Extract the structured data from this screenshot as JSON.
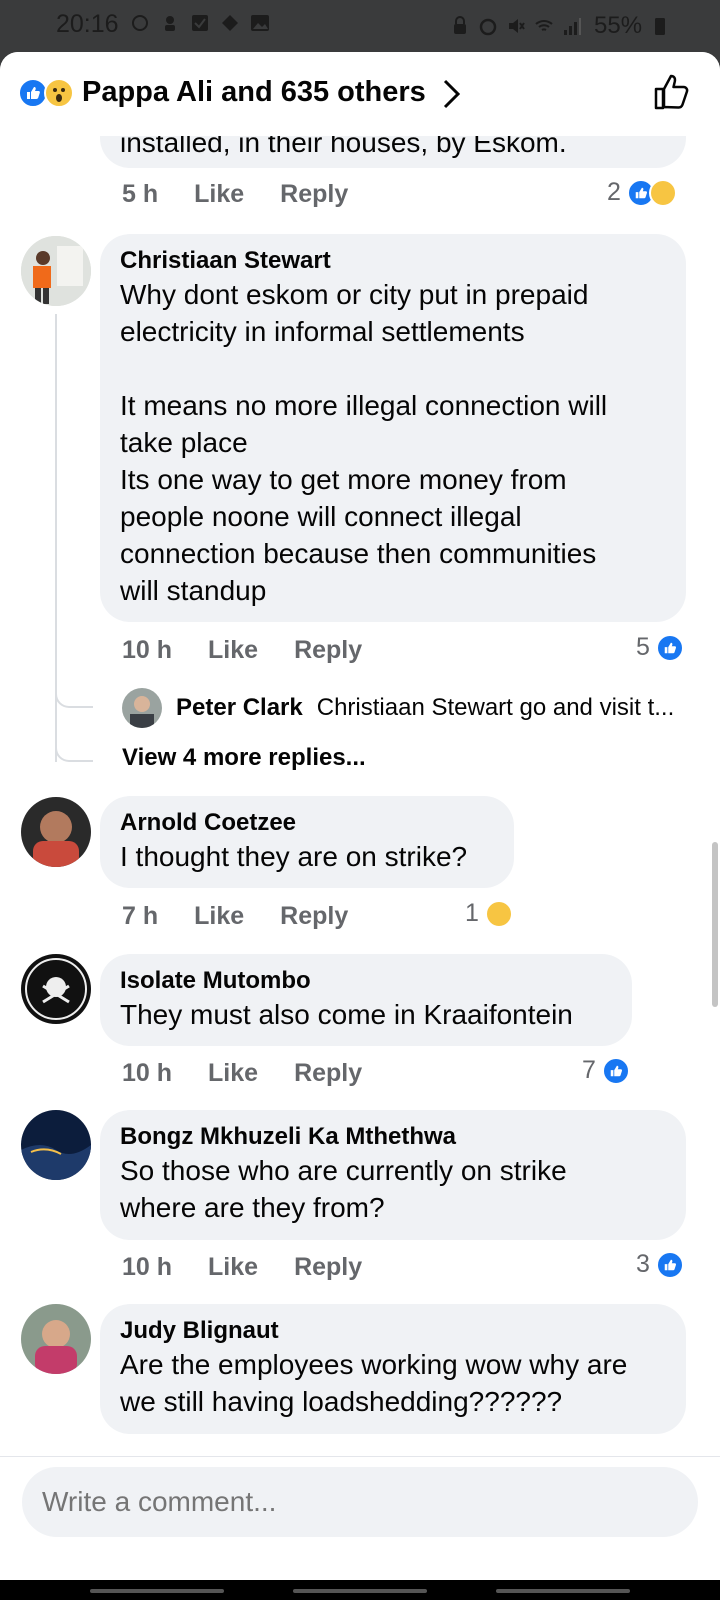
{
  "status_bar": {
    "time": "20:16",
    "battery": "55%"
  },
  "header": {
    "reactions_summary": "Pappa Ali and 635 others",
    "like_icon": "thumbs-up-outline-icon"
  },
  "comments": [
    {
      "text": "installed, in their houses, by Eskom.",
      "time": "5 h",
      "like_label": "Like",
      "reply_label": "Reply",
      "reaction_count": "2"
    },
    {
      "author": "Christiaan Stewart",
      "text": "Why dont eskom or city put in prepaid\nelectricity in informal settlements\n\nIt means no more illegal connection will\ntake place\nIts one way to get more money from\npeople noone will connect illegal\nconnection because then communities\nwill standup",
      "time": "10 h",
      "like_label": "Like",
      "reply_label": "Reply",
      "reaction_count": "5",
      "reply_preview": {
        "author": "Peter Clark",
        "text": "Christiaan Stewart go and visit t..."
      },
      "view_more": "View 4 more replies..."
    },
    {
      "author": "Arnold Coetzee",
      "text": "I thought they are on strike?",
      "time": "7 h",
      "like_label": "Like",
      "reply_label": "Reply",
      "reaction_count": "1"
    },
    {
      "author": "Isolate Mutombo",
      "text": "They must also come in Kraaifontein",
      "time": "10 h",
      "like_label": "Like",
      "reply_label": "Reply",
      "reaction_count": "7"
    },
    {
      "author": "Bongz Mkhuzeli Ka Mthethwa",
      "text": "So those who are currently on strike\nwhere are they from?",
      "time": "10 h",
      "like_label": "Like",
      "reply_label": "Reply",
      "reaction_count": "3"
    },
    {
      "author": "Judy Blignaut",
      "text": "Are the employees working wow why are\nwe still having loadshedding??????"
    }
  ],
  "composer": {
    "placeholder": "Write a comment..."
  },
  "colors": {
    "accent": "#1877f2",
    "bubble": "#f0f2f5",
    "meta": "#65676b"
  }
}
